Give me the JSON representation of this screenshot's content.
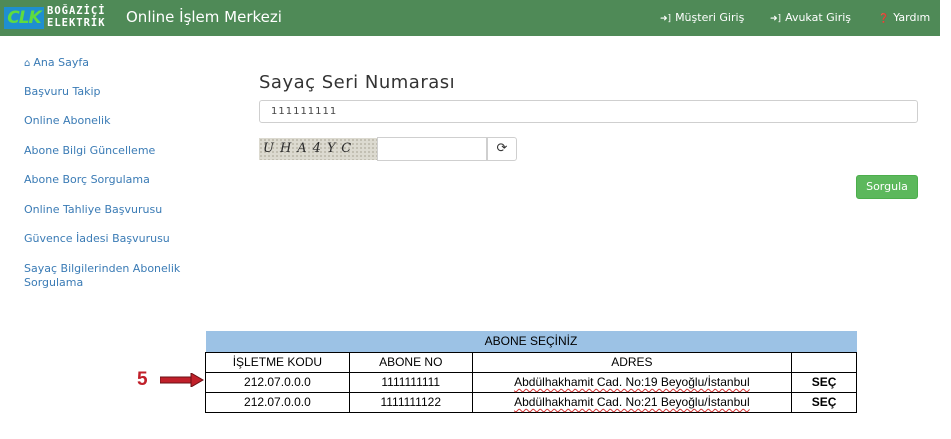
{
  "header": {
    "logo_mark": "CLK",
    "logo_line1": "BOĞAZİÇİ",
    "logo_line2": "ELEKTRİK",
    "title": "Online İşlem Merkezi",
    "nav": [
      {
        "label": "Müşteri Giriş",
        "icon": "sign-in-icon"
      },
      {
        "label": "Avukat Giriş",
        "icon": "sign-in-icon"
      },
      {
        "label": "Yardım",
        "icon": "question-circle-icon"
      }
    ]
  },
  "sidebar": {
    "items": [
      {
        "label": "Ana Sayfa",
        "icon": "home-icon"
      },
      {
        "label": "Başvuru Takip"
      },
      {
        "label": "Online Abonelik"
      },
      {
        "label": "Abone Bilgi Güncelleme"
      },
      {
        "label": "Abone Borç Sorgulama"
      },
      {
        "label": "Online Tahliye Başvurusu"
      },
      {
        "label": "Güvence İadesi Başvurusu"
      },
      {
        "label": "Sayaç Bilgilerinden Abonelik Sorgulama"
      }
    ]
  },
  "form": {
    "title": "Sayaç Seri Numarası",
    "serial_value": "111111111",
    "captcha_text": "UHA4YC",
    "captcha_value": "",
    "submit_label": "Sorgula"
  },
  "annotation": {
    "step": "5"
  },
  "table": {
    "caption": "ABONE SEÇİNİZ",
    "headers": [
      "İŞLETME KODU",
      "ABONE NO",
      "ADRES",
      ""
    ],
    "rows": [
      {
        "code": "212.07.0.0.0",
        "abone_no": "1111111111",
        "address": "Abdülhakhamit Cad. No:19  Beyoğlu/İstanbul",
        "action": "SEÇ"
      },
      {
        "code": "212.07.0.0.0",
        "abone_no": "1111111122",
        "address": "Abdülhakhamit Cad. No:21 Beyoğlu/İstanbul",
        "action": "SEÇ"
      }
    ]
  },
  "colors": {
    "navbar": "#4f8a57",
    "link": "#3a7bb5",
    "button": "#5cb85c",
    "table_caption": "#9cc2e5",
    "annotation": "#c0202a"
  }
}
